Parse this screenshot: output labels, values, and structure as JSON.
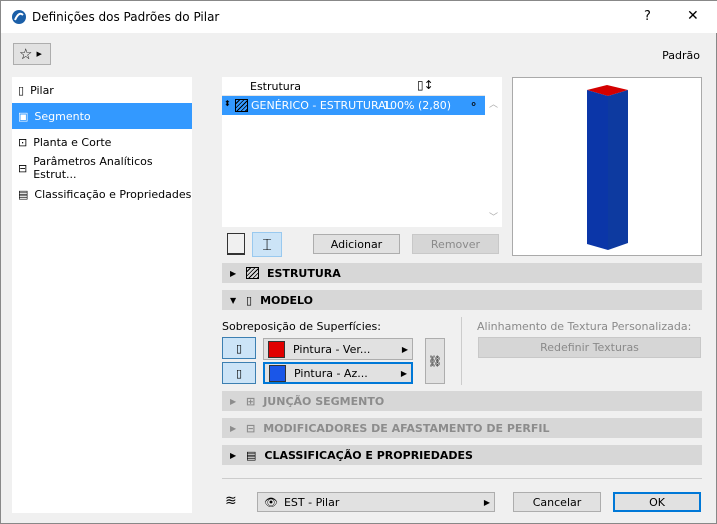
{
  "window": {
    "title": "Definições dos Padrões do Pilar",
    "help": "?",
    "close": "✕"
  },
  "toolbar": {
    "favorites_icon": "star-icon",
    "preset": "Padrão"
  },
  "sidebar": {
    "items": [
      {
        "label": "Pilar",
        "icon": "pillar-icon",
        "selected": false
      },
      {
        "label": "Segmento",
        "icon": "segment-icon",
        "selected": true
      },
      {
        "label": "Planta e Corte",
        "icon": "floorplan-icon",
        "selected": false
      },
      {
        "label": "Parâmetros Analíticos Estrut...",
        "icon": "analytic-icon",
        "selected": false
      },
      {
        "label": "Classificação e Propriedades",
        "icon": "document-icon",
        "selected": false
      }
    ]
  },
  "structure_table": {
    "header": "Estrutura",
    "rows": [
      {
        "material": "GENÉRICO - ESTRUTURAL",
        "value": "100% (2,80)"
      }
    ],
    "add_label": "Adicionar",
    "remove_label": "Remover"
  },
  "sections": {
    "estrutura": "ESTRUTURA",
    "modelo": "MODELO",
    "juncao": "JUNÇÃO SEGMENTO",
    "modificadores": "MODIFICADORES DE AFASTAMENTO DE PERFIL",
    "classificacao": "CLASSIFICAÇÃO E PROPRIEDADES"
  },
  "modelo": {
    "surface_label": "Sobreposição de Superfícies:",
    "surfaces": [
      {
        "label": "Pintura - Ver...",
        "color": "#e00000"
      },
      {
        "label": "Pintura - Az...",
        "color": "#1a56e8"
      }
    ],
    "texture_label": "Alinhamento de Textura Personalizada:",
    "reset_textures": "Redefinir Texturas"
  },
  "footer": {
    "layer": "EST - Pilar",
    "cancel": "Cancelar",
    "ok": "OK"
  },
  "colors": {
    "selection": "#3399ff",
    "pillar_body": "#0b36a8",
    "pillar_top": "#d40000"
  }
}
